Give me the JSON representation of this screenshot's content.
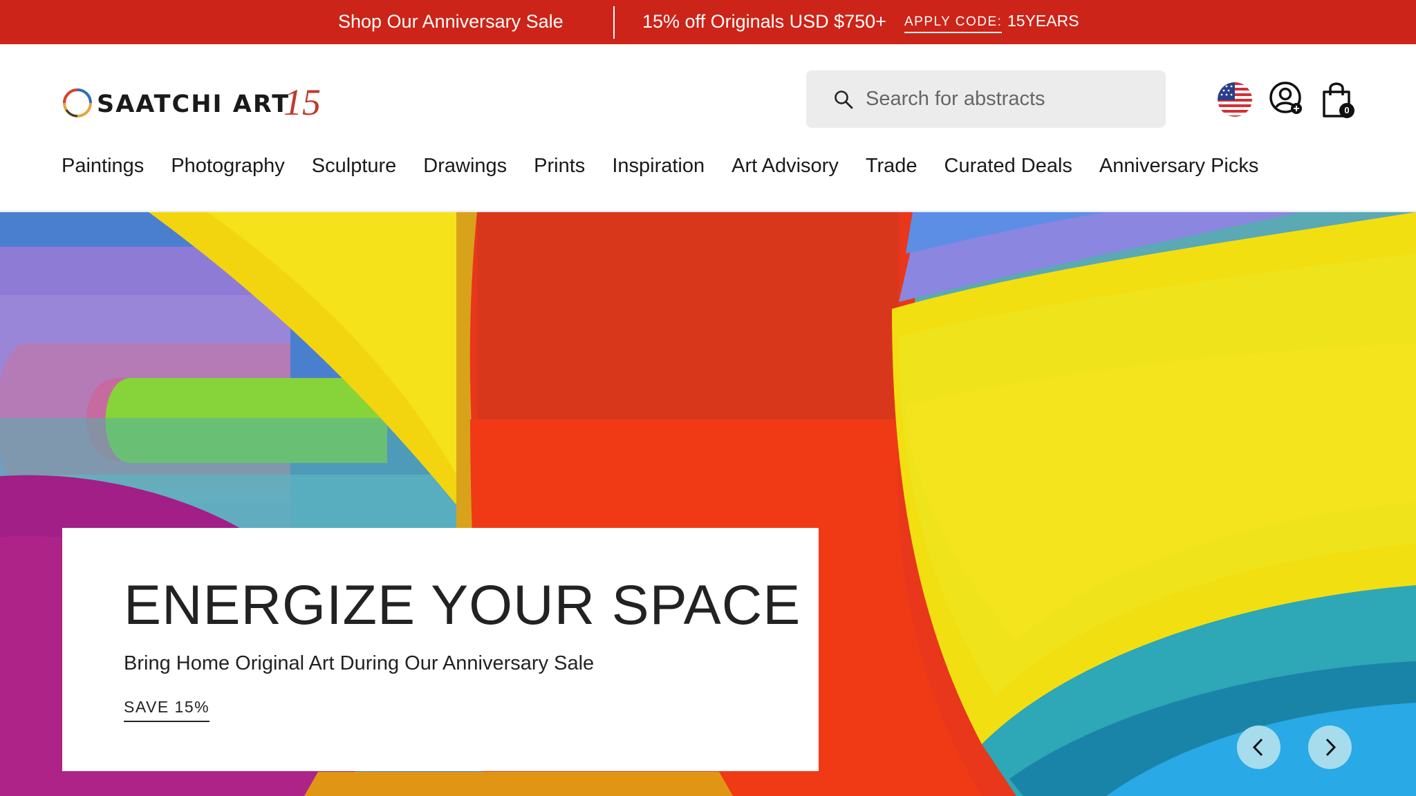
{
  "promo": {
    "sale_link": "Shop Our Anniversary Sale",
    "offer": "15% off Originals USD $750+",
    "code_label": "APPLY CODE:",
    "code": "15YEARS"
  },
  "header": {
    "logo_text": "SAATCHI ART",
    "logo_badge": "15",
    "search_placeholder": "Search for abstracts",
    "cart_count": "0"
  },
  "nav": {
    "items": [
      "Paintings",
      "Photography",
      "Sculpture",
      "Drawings",
      "Prints",
      "Inspiration",
      "Art Advisory",
      "Trade",
      "Curated Deals",
      "Anniversary Picks"
    ]
  },
  "hero": {
    "title": "ENERGIZE YOUR SPACE",
    "subtitle": "Bring Home Original Art During Our Anniversary Sale",
    "cta": "SAVE 15%"
  },
  "icons": {
    "search": "search-icon",
    "flag": "us-flag-icon",
    "account": "account-icon",
    "cart": "shopping-bag-icon",
    "prev": "chevron-left-icon",
    "next": "chevron-right-icon"
  },
  "colors": {
    "promo_bar": "#cc2418",
    "carousel_button": "#a6dcec",
    "logo_accent": "#c0392b"
  }
}
